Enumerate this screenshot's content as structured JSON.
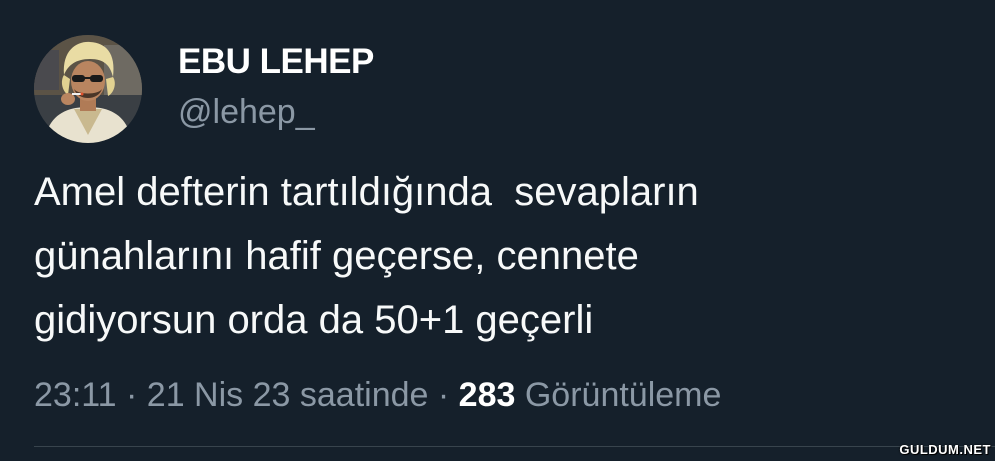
{
  "tweet": {
    "display_name": "EBU LEHEP",
    "handle": "@lehep_",
    "text": "Amel defterin tartıldığında  sevapların\ngünahlarını hafif geçerse, cennete\ngidiyorsun orda da 50+1 geçerli",
    "time": "23:11",
    "separator": "·",
    "date": "21 Nis 23 saatinde",
    "view_count": "283",
    "view_label": "Görüntüleme"
  },
  "watermark": {
    "text": "GULDUM.NET"
  },
  "colors": {
    "background": "#15202b",
    "text_primary": "#f7f9f9",
    "text_secondary": "#8b98a5",
    "divider": "#38444d"
  },
  "icons": {
    "avatar": "profile-avatar-image"
  }
}
